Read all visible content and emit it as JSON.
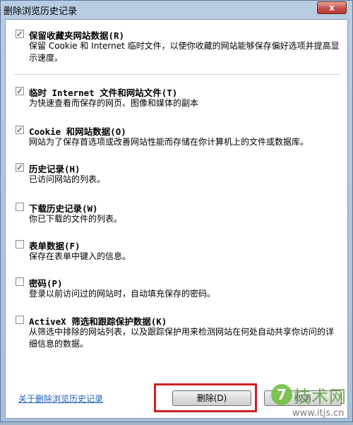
{
  "window": {
    "title": "删除浏览历史记录",
    "close_label": "x"
  },
  "items": [
    {
      "label": "保留收藏夹网站数据(R)",
      "desc": "保留 Cookie 和 Internet 临时文件，以使你收藏的网站能够保存偏好选项并提高显示速度。",
      "checked": true
    },
    {
      "label": "临时 Internet 文件和网站文件(T)",
      "desc": "为快速查看而保存的网页、图像和媒体的副本",
      "checked": true
    },
    {
      "label": "Cookie 和网站数据(O)",
      "desc": "网站为了保存首选项或改善网站性能而存储在你计算机上的文件或数据库。",
      "checked": true
    },
    {
      "label": "历史记录(H)",
      "desc": "已访问网站的列表。",
      "checked": true
    },
    {
      "label": "下载历史记录(W)",
      "desc": "你已下载的文件的列表。",
      "checked": false
    },
    {
      "label": "表单数据(F)",
      "desc": "保存在表单中键入的信息。",
      "checked": false
    },
    {
      "label": "密码(P)",
      "desc": "登录以前访问过的网站时，自动填充保存的密码。",
      "checked": false
    },
    {
      "label": "ActiveX 筛选和跟踪保护数据(K)",
      "desc": "从筛选中排除的网站列表，以及跟踪保护用来检测网站在何处自动共享你访问的详细信息的数据。",
      "checked": false
    }
  ],
  "footer": {
    "link": "关于删除浏览历史记录",
    "delete_label": "删除(D)",
    "cancel_label": "取消"
  },
  "watermark": {
    "logo": "7",
    "name": "技术网",
    "url": "www.itjs.cn"
  }
}
